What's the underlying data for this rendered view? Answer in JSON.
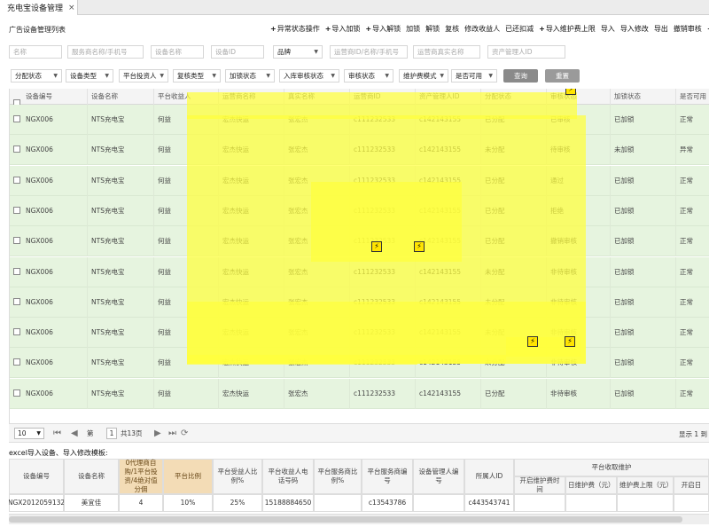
{
  "tab": {
    "title": "充电宝设备管理",
    "close": "×"
  },
  "panel": {
    "title": "广告设备管理列表"
  },
  "toolbar": {
    "items": [
      {
        "label": "异常状态操作",
        "plus": true
      },
      {
        "label": "导入加锁",
        "plus": true
      },
      {
        "label": "导入解锁",
        "plus": true
      },
      {
        "label": "加锁",
        "plus": false
      },
      {
        "label": "解锁",
        "plus": false
      },
      {
        "label": "复核",
        "plus": false
      },
      {
        "label": "修改收益人",
        "plus": false
      },
      {
        "label": "已还扣减",
        "plus": false
      },
      {
        "label": "导入维护费上限",
        "plus": true
      },
      {
        "label": "导入",
        "plus": false
      },
      {
        "label": "导入修改",
        "plus": false
      },
      {
        "label": "导出",
        "plus": false
      },
      {
        "label": "撤销审核",
        "plus": false
      },
      {
        "label": "",
        "plus": true
      }
    ]
  },
  "filters": {
    "name": "名称",
    "operator_name_phone": "服务商名称/手机号",
    "device_name": "设备名称",
    "device_id": "设备ID",
    "brand": "品牌",
    "operator_id_name_phone": "运营商ID/名称/手机号",
    "operator_real_name": "运营商真实名称",
    "asset_admin_id": "资产管理人ID"
  },
  "selects": {
    "allocation_status": "分配状态",
    "device_type": "设备类型",
    "platform_investor": "平台投资人",
    "review_type": "复核类型",
    "lock_status": "加锁状态",
    "stock_review_status": "入库审核状态",
    "review_status": "审核状态",
    "maintenance_mode": "维护费模式",
    "available": "是否可用"
  },
  "buttons": {
    "query": "查询",
    "reset": "重置"
  },
  "grid": {
    "columns": [
      "设备编号",
      "设备名称",
      "平台收益人",
      "运营商名称",
      "真实名称",
      "运营商ID",
      "资产管理人ID",
      "分配状态",
      "审核状态",
      "加锁状态",
      "是否可用"
    ],
    "rows": [
      [
        "NGX006",
        "NTS充电宝",
        "何益",
        "宏杰快运",
        "张宏杰",
        "c111232533",
        "c142143155",
        "已分配",
        "已审核",
        "已加锁",
        "正常"
      ],
      [
        "NGX006",
        "NTS充电宝",
        "何益",
        "宏杰快运",
        "张宏杰",
        "c111232533",
        "c142143155",
        "未分配",
        "待审核",
        "未加锁",
        "异常"
      ],
      [
        "NGX006",
        "NTS充电宝",
        "何益",
        "宏杰快运",
        "张宏杰",
        "c111232533",
        "c142143155",
        "已分配",
        "通过",
        "已加锁",
        "正常"
      ],
      [
        "NGX006",
        "NTS充电宝",
        "何益",
        "宏杰快运",
        "张宏杰",
        "c111232533",
        "c142143155",
        "已分配",
        "拒绝",
        "已加锁",
        "正常"
      ],
      [
        "NGX006",
        "NTS充电宝",
        "何益",
        "宏杰快运",
        "张宏杰",
        "c111232533",
        "c142143155",
        "已分配",
        "撤销审核",
        "已加锁",
        "正常"
      ],
      [
        "NGX006",
        "NTS充电宝",
        "何益",
        "宏杰快运",
        "张宏杰",
        "c111232533",
        "c142143155",
        "未分配",
        "非待审核",
        "已加锁",
        "正常"
      ],
      [
        "NGX006",
        "NTS充电宝",
        "何益",
        "宏杰快运",
        "张宏杰",
        "c111232533",
        "c142143155",
        "未分配",
        "非待审核",
        "已加锁",
        "正常"
      ],
      [
        "NGX006",
        "NTS充电宝",
        "何益",
        "宏杰快运",
        "张宏杰",
        "c111232533",
        "c142143155",
        "未分配",
        "非待审核",
        "已加锁",
        "正常"
      ],
      [
        "NGX006",
        "NTS充电宝",
        "何益",
        "宏杰快运",
        "张宏杰",
        "c111232533",
        "c142143155",
        "未分配",
        "非待审核",
        "已加锁",
        "正常"
      ],
      [
        "NGX006",
        "NTS充电宝",
        "何益",
        "宏杰快运",
        "张宏杰",
        "c111232533",
        "c142143155",
        "已分配",
        "非待审核",
        "已加锁",
        "正常"
      ]
    ],
    "bolt_icon": "⚡"
  },
  "pager": {
    "page_size": "10",
    "page_prefix": "第",
    "page": "1",
    "page_suffix": "共13页",
    "info": "显示 1 到"
  },
  "template": {
    "title": "excel导入设备、导入修改模板:",
    "headers": {
      "device_no": "设备编号",
      "device_name": "设备名称",
      "agent_type": "0代理商自购/1平台投资/4绝对值分佣",
      "platform_ratio": "平台比例",
      "platform_benefit_ratio": "平台受益人比例%",
      "platform_benefit_phone": "平台收益人电话号码",
      "platform_operator_ratio": "平台服务商比例%",
      "platform_operator_no": "平台服务商编号",
      "asset_admin_no": "设备管理人编号",
      "owner_id": "所属人ID",
      "platform_fee_group": "平台收取维护",
      "enable_time": "开启维护费时间",
      "daily_fee": "日维护费（元）",
      "fee_limit": "维护费上限（元）",
      "enable_day": "开启日"
    },
    "row": {
      "device_no": "NGX2012059132",
      "device_name": "美宜佳",
      "agent_type": "4",
      "platform_ratio": "10%",
      "platform_benefit_ratio": "25%",
      "platform_benefit_phone": "15188884650",
      "platform_operator_ratio": "",
      "platform_operator_no": "c13543786",
      "asset_admin_no": "",
      "owner_id": "c443543741"
    }
  },
  "colors": {
    "row_bg": "#e6f4df",
    "highlight": "#ffff3c",
    "reset_button": "#9a9a9a",
    "query_button": "#8a8a8a",
    "tan_header": "#f3dcb6"
  }
}
